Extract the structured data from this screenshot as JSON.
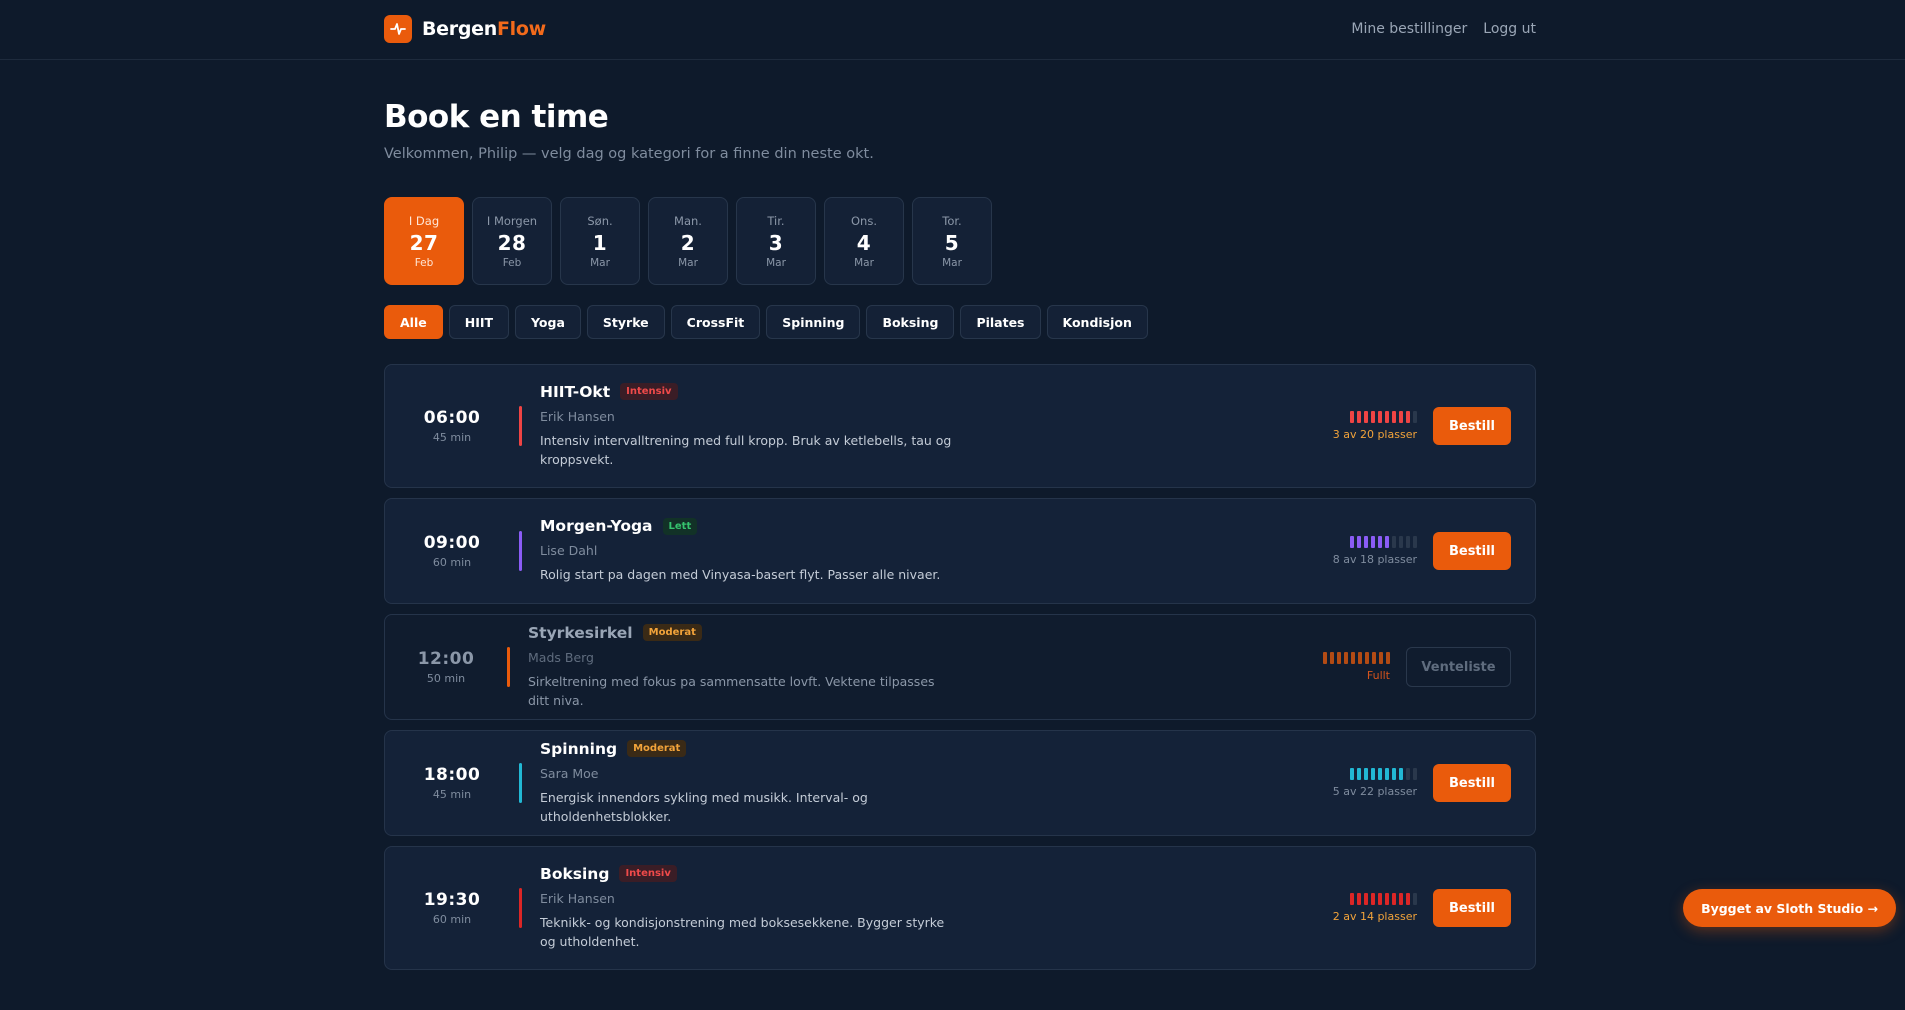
{
  "brand": {
    "name_main": "Bergen",
    "name_accent": "Flow",
    "logo_icon": "pulse-icon"
  },
  "nav": {
    "bookings": "Mine bestillinger",
    "logout": "Logg ut"
  },
  "page": {
    "title": "Book en time",
    "subtitle": "Velkommen, Philip — velg dag og kategori for a finne din neste okt."
  },
  "days": [
    {
      "label": "I Dag",
      "num": "27",
      "month": "Feb",
      "active": true
    },
    {
      "label": "I Morgen",
      "num": "28",
      "month": "Feb",
      "active": false
    },
    {
      "label": "Søn.",
      "num": "1",
      "month": "Mar",
      "active": false
    },
    {
      "label": "Man.",
      "num": "2",
      "month": "Mar",
      "active": false
    },
    {
      "label": "Tir.",
      "num": "3",
      "month": "Mar",
      "active": false
    },
    {
      "label": "Ons.",
      "num": "4",
      "month": "Mar",
      "active": false
    },
    {
      "label": "Tor.",
      "num": "5",
      "month": "Mar",
      "active": false
    }
  ],
  "categories": [
    {
      "label": "Alle",
      "active": true
    },
    {
      "label": "HIIT",
      "active": false
    },
    {
      "label": "Yoga",
      "active": false
    },
    {
      "label": "Styrke",
      "active": false
    },
    {
      "label": "CrossFit",
      "active": false
    },
    {
      "label": "Spinning",
      "active": false
    },
    {
      "label": "Boksing",
      "active": false
    },
    {
      "label": "Pilates",
      "active": false
    },
    {
      "label": "Kondisjon",
      "active": false
    }
  ],
  "classes": [
    {
      "time": "06:00",
      "duration": "45 min",
      "name": "HIIT-Okt",
      "level": "Intensiv",
      "level_class": "intensiv",
      "instructor": "Erik Hansen",
      "description": "Intensiv intervalltrening med full kropp. Bruk av ketlebells, tau og kroppsvekt.",
      "accent": "#ef4444",
      "booked": 17,
      "capacity": 20,
      "capacity_text": "3 av 20 plasser",
      "capacity_text_color": "#f2a33a",
      "button": "Bestill",
      "full": false
    },
    {
      "time": "09:00",
      "duration": "60 min",
      "name": "Morgen-Yoga",
      "level": "Lett",
      "level_class": "lett",
      "instructor": "Lise Dahl",
      "description": "Rolig start pa dagen med Vinyasa-basert flyt. Passer alle nivaer.",
      "accent": "#8b5cf6",
      "booked": 10,
      "capacity": 18,
      "capacity_text": "8 av 18 plasser",
      "capacity_text_color": "#7f8c9e",
      "button": "Bestill",
      "full": false
    },
    {
      "time": "12:00",
      "duration": "50 min",
      "name": "Styrkesirkel",
      "level": "Moderat",
      "level_class": "moderat",
      "instructor": "Mads Berg",
      "description": "Sirkeltrening med fokus pa sammensatte lovft. Vektene tilpasses ditt niva.",
      "accent": "#ea5b0c",
      "booked": 16,
      "capacity": 16,
      "capacity_text": "Fullt",
      "capacity_text_color": "#d4541c",
      "button": "Venteliste",
      "full": true
    },
    {
      "time": "18:00",
      "duration": "45 min",
      "name": "Spinning",
      "level": "Moderat",
      "level_class": "moderat",
      "instructor": "Sara Moe",
      "description": "Energisk innendors sykling med musikk. Interval- og utholdenhetsblokker.",
      "accent": "#22b8d4",
      "booked": 17,
      "capacity": 22,
      "capacity_text": "5 av 22 plasser",
      "capacity_text_color": "#7f8c9e",
      "button": "Bestill",
      "full": false
    },
    {
      "time": "19:30",
      "duration": "60 min",
      "name": "Boksing",
      "level": "Intensiv",
      "level_class": "intensiv",
      "instructor": "Erik Hansen",
      "description": "Teknikk- og kondisjonstrening med boksesekkene. Bygger styrke og utholdenhet.",
      "accent": "#dc2626",
      "booked": 12,
      "capacity": 14,
      "capacity_text": "2 av 14 plasser",
      "capacity_text_color": "#f2a33a",
      "button": "Bestill",
      "full": false
    }
  ],
  "footer": {
    "label": "Bygget av Sloth Studio →"
  },
  "colors": {
    "accent": "#ea5b0c",
    "background": "#0e1a2b",
    "card": "#142238"
  }
}
